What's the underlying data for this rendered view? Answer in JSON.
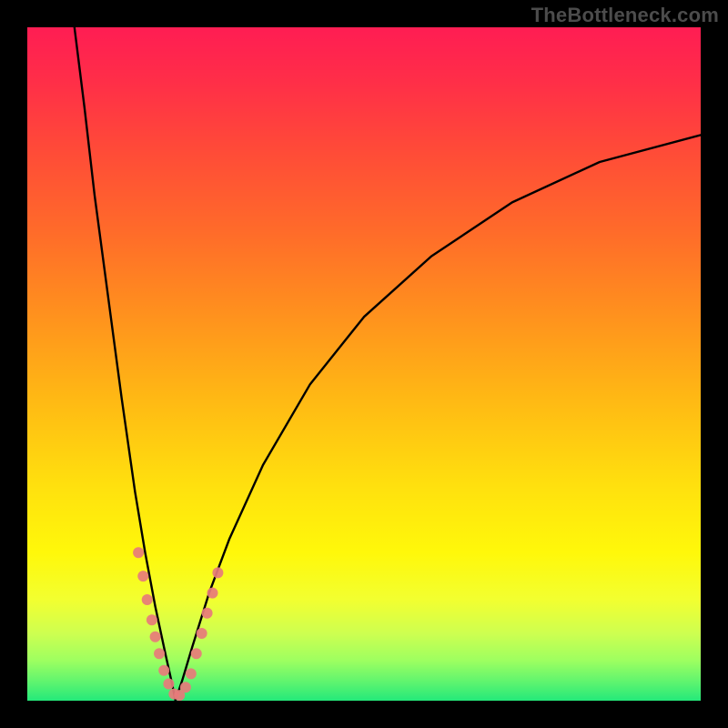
{
  "watermark": "TheBottleneck.com",
  "chart_data": {
    "type": "line",
    "title": "",
    "xlabel": "",
    "ylabel": "",
    "xlim": [
      0,
      100
    ],
    "ylim": [
      0,
      100
    ],
    "grid": false,
    "legend": false,
    "notes": "Two black curves forming a V-shaped dip near x≈22, y=0; rainbow vertical gradient background from red (top) through orange/yellow to green (bottom); cluster of salmon dots along both curve branches near the dip between y≈0 and y≈20.",
    "background_gradient_stops": [
      {
        "offset": 0.0,
        "color": "#ff1d53"
      },
      {
        "offset": 0.08,
        "color": "#ff2e48"
      },
      {
        "offset": 0.18,
        "color": "#ff4a38"
      },
      {
        "offset": 0.3,
        "color": "#ff6a2a"
      },
      {
        "offset": 0.42,
        "color": "#ff8f1e"
      },
      {
        "offset": 0.55,
        "color": "#ffb814"
      },
      {
        "offset": 0.68,
        "color": "#ffe00e"
      },
      {
        "offset": 0.78,
        "color": "#fff80a"
      },
      {
        "offset": 0.85,
        "color": "#f2ff30"
      },
      {
        "offset": 0.9,
        "color": "#ceff50"
      },
      {
        "offset": 0.94,
        "color": "#9eff60"
      },
      {
        "offset": 0.97,
        "color": "#63f56e"
      },
      {
        "offset": 1.0,
        "color": "#24e97a"
      }
    ],
    "series": [
      {
        "name": "left-branch",
        "color": "#000000",
        "x": [
          7.0,
          8.5,
          10.0,
          12.0,
          14.0,
          16.0,
          17.5,
          19.0,
          20.5,
          21.5,
          22.0
        ],
        "y": [
          100.0,
          88.0,
          75.0,
          60.0,
          45.0,
          31.0,
          22.0,
          14.0,
          7.0,
          2.5,
          0.0
        ]
      },
      {
        "name": "right-branch",
        "color": "#000000",
        "x": [
          22.0,
          23.0,
          24.5,
          27.0,
          30.0,
          35.0,
          42.0,
          50.0,
          60.0,
          72.0,
          85.0,
          100.0
        ],
        "y": [
          0.0,
          3.0,
          8.0,
          16.0,
          24.0,
          35.0,
          47.0,
          57.0,
          66.0,
          74.0,
          80.0,
          84.0
        ]
      }
    ],
    "markers": {
      "name": "dots-near-dip",
      "color": "#e77b7b",
      "radius": 6,
      "points": [
        {
          "x": 16.5,
          "y": 22.0
        },
        {
          "x": 17.2,
          "y": 18.5
        },
        {
          "x": 17.8,
          "y": 15.0
        },
        {
          "x": 18.5,
          "y": 12.0
        },
        {
          "x": 19.0,
          "y": 9.5
        },
        {
          "x": 19.6,
          "y": 7.0
        },
        {
          "x": 20.3,
          "y": 4.5
        },
        {
          "x": 21.0,
          "y": 2.5
        },
        {
          "x": 21.8,
          "y": 1.0
        },
        {
          "x": 22.6,
          "y": 0.8
        },
        {
          "x": 23.5,
          "y": 2.0
        },
        {
          "x": 24.3,
          "y": 4.0
        },
        {
          "x": 25.1,
          "y": 7.0
        },
        {
          "x": 25.9,
          "y": 10.0
        },
        {
          "x": 26.7,
          "y": 13.0
        },
        {
          "x": 27.5,
          "y": 16.0
        },
        {
          "x": 28.3,
          "y": 19.0
        }
      ]
    }
  }
}
